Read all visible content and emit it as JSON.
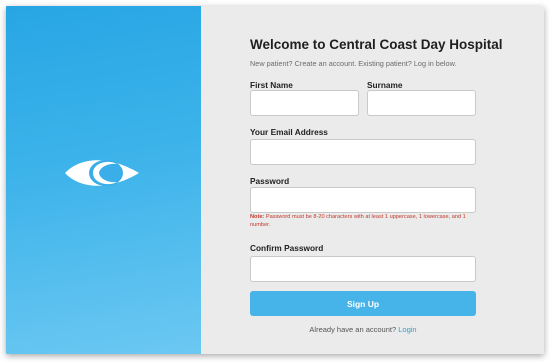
{
  "brand": {
    "logo_icon": "eye-logo-icon",
    "panel_color": "#34aeea"
  },
  "form": {
    "title": "Welcome to Central Coast Day Hospital",
    "subtitle": "New patient? Create an account. Existing patient? Log in below.",
    "first_name": {
      "label": "First Name",
      "value": "",
      "placeholder": ""
    },
    "surname": {
      "label": "Surname",
      "value": "",
      "placeholder": ""
    },
    "email": {
      "label": "Your Email Address",
      "value": "",
      "placeholder": ""
    },
    "password": {
      "label": "Password",
      "value": "",
      "placeholder": ""
    },
    "note": {
      "prefix": "Note:",
      "text": " Password must be 8-20 characters with at least 1 uppercase, 1 lowercase, and 1 number."
    },
    "confirm_password": {
      "label": "Confirm Password",
      "value": "",
      "placeholder": ""
    },
    "signup_label": "Sign Up",
    "login_prompt": "Already have an account?",
    "login_link": "Login"
  },
  "colors": {
    "accent": "#46b4e8",
    "link": "#2a9fd6",
    "note": "#c0392b",
    "form_bg": "#ebebeb"
  }
}
